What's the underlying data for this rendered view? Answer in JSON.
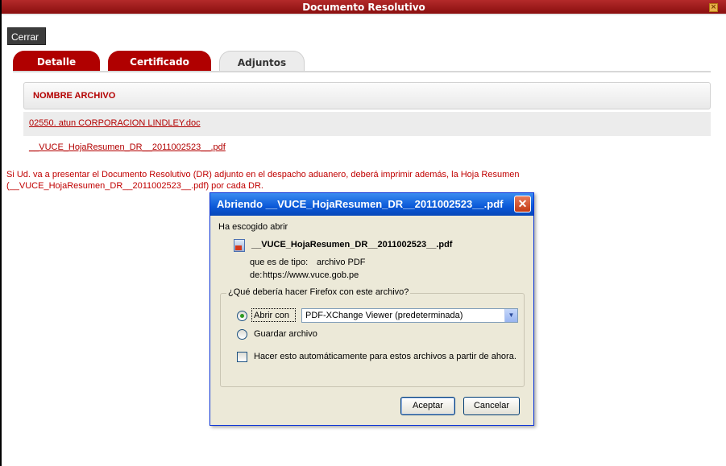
{
  "window": {
    "title": "Documento Resolutivo"
  },
  "toolbar": {
    "close_label": "Cerrar"
  },
  "tabs": [
    {
      "label": "Detalle"
    },
    {
      "label": "Certificado"
    },
    {
      "label": "Adjuntos"
    }
  ],
  "table": {
    "header": "NOMBRE ARCHIVO",
    "files": [
      "02550. atun CORPORACION LINDLEY.doc",
      "__VUCE_HojaResumen_DR__2011002523__.pdf"
    ]
  },
  "notice": "Si Ud. va a presentar el Documento Resolutivo (DR) adjunto en el despacho aduanero, deberá imprimir además, la Hoja Resumen (__VUCE_HojaResumen_DR__2011002523__.pdf) por cada DR.",
  "dialog": {
    "title": "Abriendo __VUCE_HojaResumen_DR__2011002523__.pdf",
    "intro": "Ha escogido abrir",
    "filename": "__VUCE_HojaResumen_DR__2011002523__.pdf",
    "type_label": "que es de tipo:",
    "type_value": "archivo PDF",
    "from_label": "de:",
    "from_value": "https://www.vuce.gob.pe",
    "question": "¿Qué debería hacer Firefox con este archivo?",
    "open_with_label": "Abrir con",
    "open_with_app": "PDF-XChange Viewer (predeterminada)",
    "save_label": "Guardar archivo",
    "auto_label": "Hacer esto automáticamente para estos archivos a partir de ahora.",
    "accept_label": "Aceptar",
    "cancel_label": "Cancelar"
  },
  "colors": {
    "brand_red": "#b00000",
    "link_red": "#b30000",
    "xp_blue": "#0b59d8"
  }
}
